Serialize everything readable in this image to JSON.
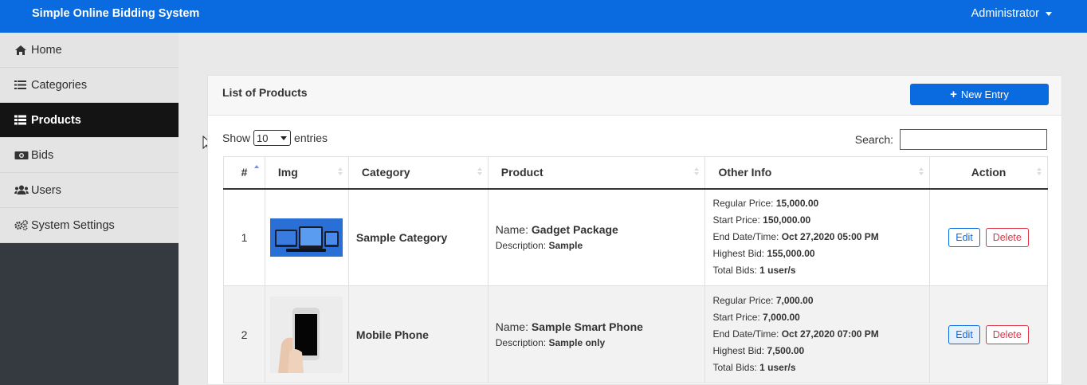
{
  "topbar": {
    "brand": "Simple Online Bidding System",
    "user": "Administrator"
  },
  "sidebar": {
    "items": [
      {
        "label": "Home",
        "icon": "home-icon"
      },
      {
        "label": "Categories",
        "icon": "list-icon"
      },
      {
        "label": "Products",
        "icon": "th-list-icon",
        "active": true
      },
      {
        "label": "Bids",
        "icon": "money-bill-icon"
      },
      {
        "label": "Users",
        "icon": "users-icon"
      },
      {
        "label": "System Settings",
        "icon": "cogs-icon"
      }
    ]
  },
  "card": {
    "title": "List of Products",
    "new_entry": "New Entry",
    "show_label": "Show",
    "entries_value": "10",
    "entries_label": "entries",
    "search_label": "Search:",
    "search_value": ""
  },
  "table": {
    "headers": [
      "#",
      "Img",
      "Category",
      "Product",
      "Other Info",
      "Action"
    ],
    "rows": [
      {
        "num": "1",
        "category": "Sample Category",
        "name_label": "Name:",
        "name": "Gadget Package",
        "desc_label": "Description:",
        "desc": "Sample",
        "regular_label": "Regular Price:",
        "regular": "15,000.00",
        "start_label": "Start Price:",
        "start": "150,000.00",
        "end_label": "End Date/Time:",
        "end": "Oct 27,2020 05:00 PM",
        "highest_label": "Highest Bid:",
        "highest": "155,000.00",
        "total_label": "Total Bids:",
        "total": "1 user/s",
        "edit": "Edit",
        "delete": "Delete"
      },
      {
        "num": "2",
        "category": "Mobile Phone",
        "name_label": "Name:",
        "name": "Sample Smart Phone",
        "desc_label": "Description:",
        "desc": "Sample only",
        "regular_label": "Regular Price:",
        "regular": "7,000.00",
        "start_label": "Start Price:",
        "start": "7,000.00",
        "end_label": "End Date/Time:",
        "end": "Oct 27,2020 07:00 PM",
        "highest_label": "Highest Bid:",
        "highest": "7,500.00",
        "total_label": "Total Bids:",
        "total": "1 user/s",
        "edit": "Edit",
        "delete": "Delete"
      }
    ]
  },
  "colors": {
    "primary": "#0a6be0",
    "sidebar_active": "#141414",
    "danger": "#dc3545"
  }
}
